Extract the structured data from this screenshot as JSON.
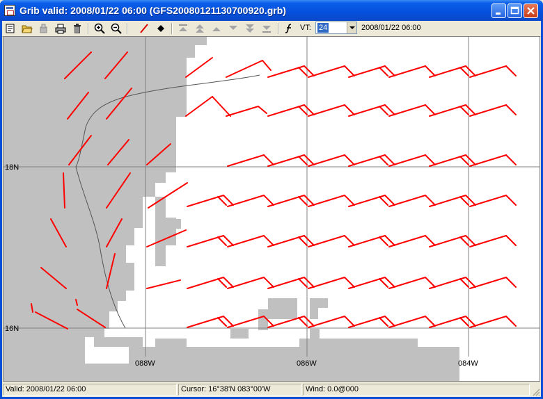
{
  "window": {
    "title": "Grib valid: 2008/01/22 06:00 (GFS20080121130700920.grb)"
  },
  "toolbar": {
    "vt_label": "VT:",
    "vt_value": "24",
    "vt_date": "2008/01/22 06:00"
  },
  "map": {
    "lat_labels": [
      "18N",
      "16N"
    ],
    "lon_labels": [
      "088W",
      "086W",
      "084W"
    ],
    "colors": {
      "land": "#c0c0c0",
      "water": "#ffffff",
      "wind": "#ff0000",
      "grid": "#808080",
      "coast": "#555555"
    }
  },
  "status": {
    "valid": "Valid: 2008/01/22 06:00",
    "cursor": "Cursor: 16°38'N  083°00'W",
    "wind": "Wind:  0.0@000"
  }
}
